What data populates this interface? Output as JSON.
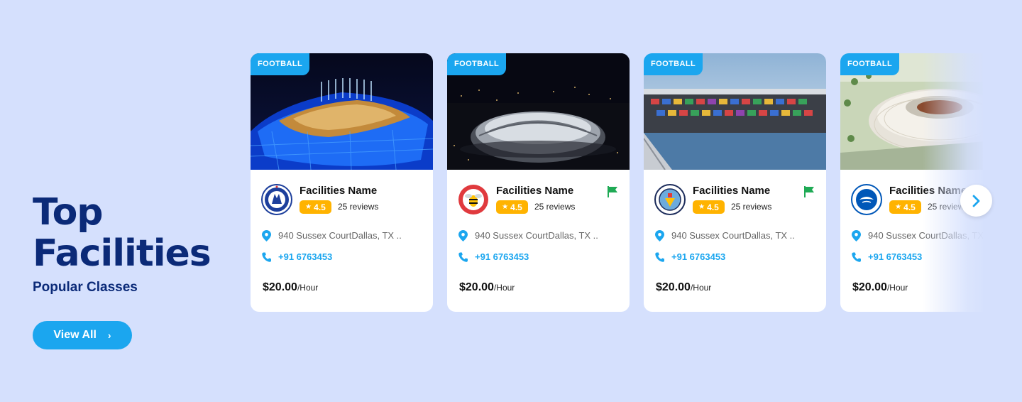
{
  "section": {
    "title_line1": "Top",
    "title_line2": "Facilities",
    "subtitle": "Popular Classes",
    "view_all_label": "View All",
    "view_all_chevron": "›"
  },
  "colors": {
    "accent": "#1ba6ef",
    "heading": "#0b2a78",
    "rating": "#ffb300",
    "flag": "#1faa55",
    "background": "#d5e0fd"
  },
  "cards": [
    {
      "tag": "FOOTBALL",
      "name": "Facilities Name",
      "rating": "4.5",
      "reviews": "25 reviews",
      "address": "940 Sussex CourtDallas, TX ..",
      "phone": "+91 6763453",
      "price": "$20.00",
      "unit": "/Hour",
      "logo": "chelsea-crest-icon",
      "flagged": false
    },
    {
      "tag": "FOOTBALL",
      "name": "Facilities Name",
      "rating": "4.5",
      "reviews": "25 reviews",
      "address": "940 Sussex CourtDallas, TX ..",
      "phone": "+91 6763453",
      "price": "$20.00",
      "unit": "/Hour",
      "logo": "brentford-crest-icon",
      "flagged": true
    },
    {
      "tag": "FOOTBALL",
      "name": "Facilities Name",
      "rating": "4.5",
      "reviews": "25 reviews",
      "address": "940 Sussex CourtDallas, TX ..",
      "phone": "+91 6763453",
      "price": "$20.00",
      "unit": "/Hour",
      "logo": "manchester-city-crest-icon",
      "flagged": true
    },
    {
      "tag": "FOOTBALL",
      "name": "Facilities Name",
      "rating": "4.5",
      "reviews": "25 reviews",
      "address": "940 Sussex CourtDallas, TX ..",
      "phone": "+91 6763453",
      "price": "$20.00",
      "unit": "/Hour",
      "logo": "brighton-crest-icon",
      "flagged": false
    }
  ],
  "carousel": {
    "next_icon": "chevron-right-icon"
  }
}
